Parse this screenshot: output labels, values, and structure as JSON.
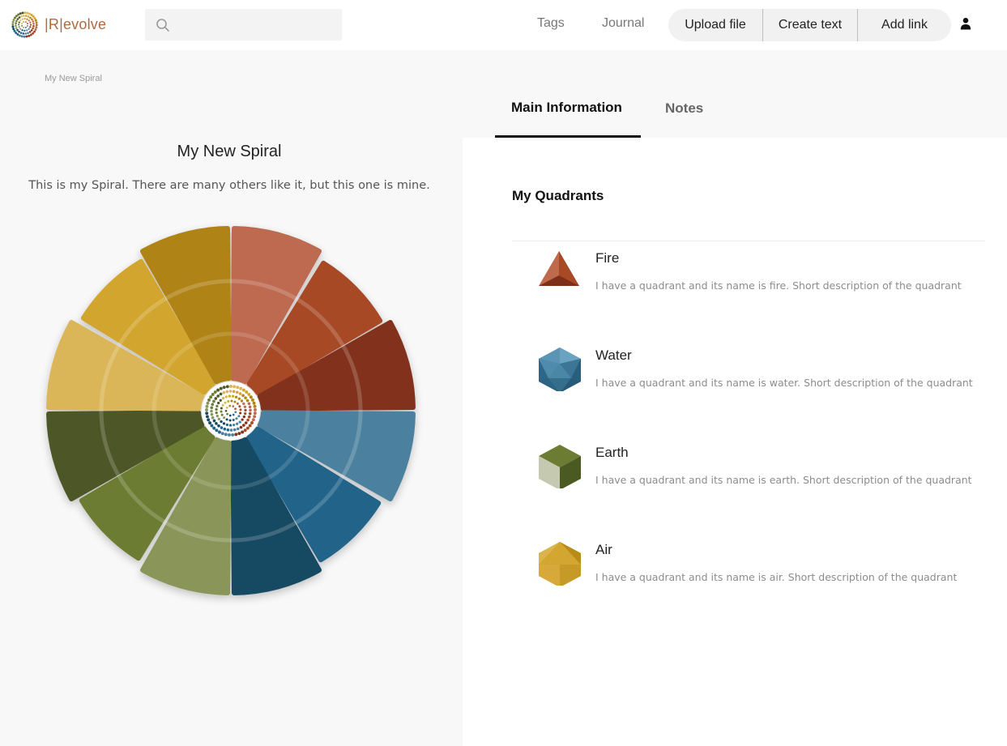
{
  "header": {
    "logo_text": "|R|evolve",
    "search_placeholder": "",
    "nav": {
      "tags": "Tags",
      "journal": "Journal"
    },
    "actions": {
      "upload": "Upload file",
      "create_text": "Create text",
      "add_link": "Add link"
    }
  },
  "breadcrumb": "My New Spiral",
  "spiral": {
    "title": "My New Spiral",
    "description": "This is my Spiral. There are many others like it, but this one is mine.",
    "segment_colors": [
      "#bd6b51",
      "#a84a25",
      "#82331c",
      "#4c819e",
      "#22648a",
      "#174962",
      "#8a955a",
      "#6c7c32",
      "#4d5725",
      "#dbb658",
      "#d2a52f",
      "#b08313"
    ]
  },
  "tabs": {
    "main": "Main Information",
    "notes": "Notes"
  },
  "quadrants": {
    "title": "My Quadrants",
    "items": [
      {
        "name": "Fire",
        "description": "I have a quadrant and its name is fire. Short description of the quadrant",
        "icon": "pyramid-icon",
        "color": "#a84a25"
      },
      {
        "name": "Water",
        "description": "I have a quadrant and its name is water. Short description of the quadrant",
        "icon": "icosahedron-icon",
        "color": "#4c819e"
      },
      {
        "name": "Earth",
        "description": "I have a quadrant and its name is earth. Short description of the quadrant",
        "icon": "cube-icon",
        "color": "#6c7c32"
      },
      {
        "name": "Air",
        "description": "I have a quadrant and its name is air. Short description of the quadrant",
        "icon": "octahedron-icon",
        "color": "#d2a52f"
      }
    ]
  }
}
